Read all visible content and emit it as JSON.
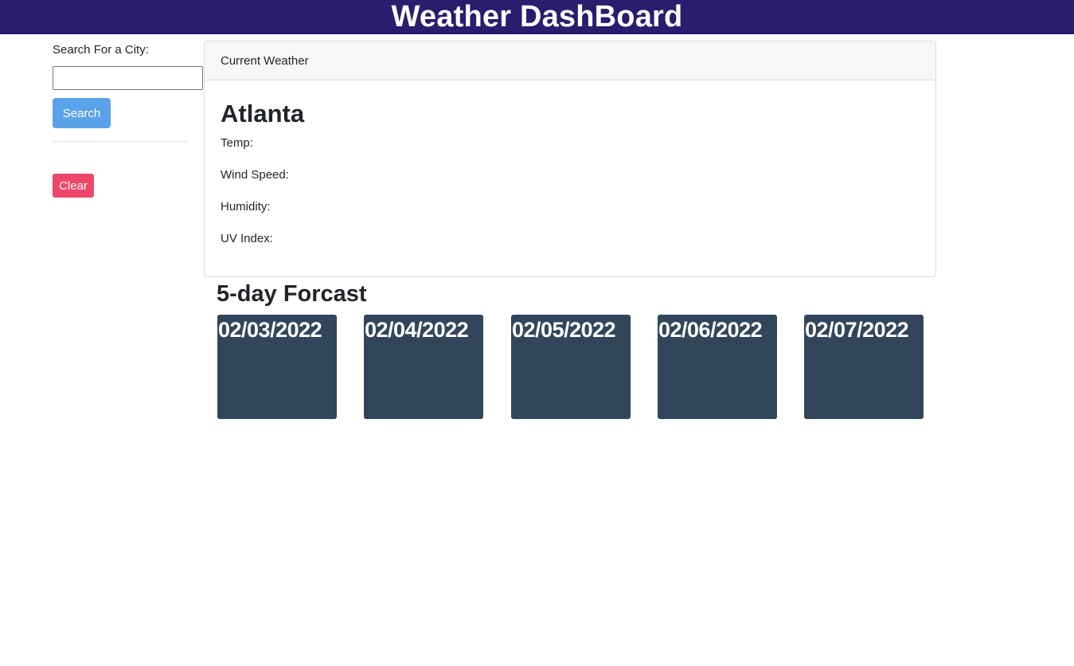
{
  "header": {
    "title": "Weather DashBoard"
  },
  "sidebar": {
    "search_label": "Search For a City:",
    "search_value": "",
    "search_button_label": "Search",
    "clear_button_label": "Clear"
  },
  "current": {
    "card_title": "Current Weather",
    "city": "Atlanta",
    "temp_label": "Temp:",
    "wind_label": "Wind Speed:",
    "humidity_label": "Humidity:",
    "uv_label": "UV Index:"
  },
  "forecast": {
    "title": "5-day Forcast",
    "days": [
      {
        "date": "02/03/2022"
      },
      {
        "date": "02/04/2022"
      },
      {
        "date": "02/05/2022"
      },
      {
        "date": "02/06/2022"
      },
      {
        "date": "02/07/2022"
      }
    ]
  },
  "colors": {
    "header_bg": "#291d6e",
    "search_button": "#5aa2ea",
    "clear_button": "#ef4669",
    "forecast_card": "#32465b"
  }
}
